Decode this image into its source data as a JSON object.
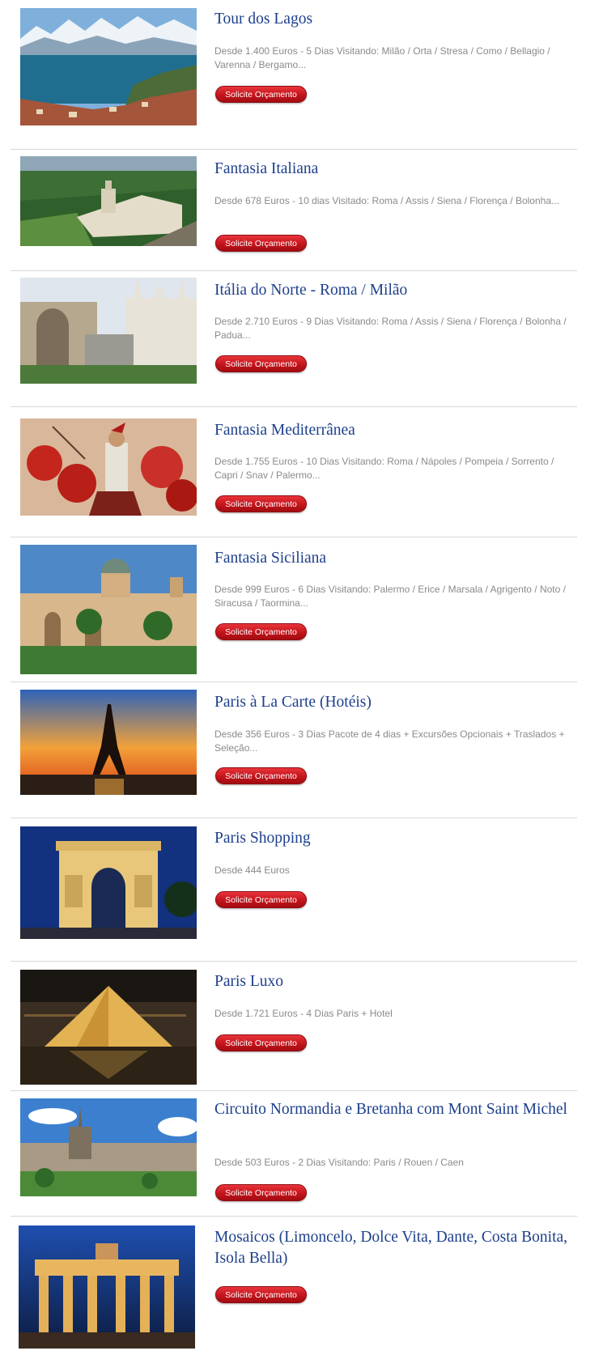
{
  "tours": [
    {
      "title": "Tour dos Lagos",
      "description": "Desde 1.400 Euros - 5 Dias Visitando: Milão / Orta / Stresa / Como / Bellagio / Varenna / Bergamo...",
      "button": "Solicite Orçamento",
      "image": "lake-mountains-photo"
    },
    {
      "title": "Fantasia Italiana",
      "description": "Desde 678 Euros - 10 dias  Visitado: Roma / Assis / Siena / Florença / Bolonha...",
      "button": "Solicite Orçamento",
      "image": "assisi-basilica-photo"
    },
    {
      "title": "Itália do Norte - Roma / Milão",
      "description": "Desde 2.710 Euros - 9 Dias Visitando: Roma / Assis / Siena / Florença / Bolonha / Padua...",
      "button": "Solicite Orçamento",
      "image": "milan-cathedral-photo"
    },
    {
      "title": "Fantasia Mediterrânea",
      "description": "Desde 1.755 Euros - 10 Dias Visitando: Roma / Nápoles / Pompeia / Sorrento / Capri / Snav / Palermo...",
      "button": "Solicite Orçamento",
      "image": "roman-soldiers-painting"
    },
    {
      "title": "Fantasia Siciliana",
      "description": "Desde 999 Euros - 6 Dias Visitando: Palermo / Erice / Marsala / Agrigento / Noto / Siracusa / Taormina...",
      "button": "Solicite Orçamento",
      "image": "palermo-cathedral-photo"
    },
    {
      "title": "Paris à La Carte (Hotéis)",
      "description": "Desde 356 Euros - 3 Dias Pacote de 4 dias + Excursões Opcionais + Traslados + Seleção...",
      "button": "Solicite Orçamento",
      "image": "eiffel-tower-sunset-photo"
    },
    {
      "title": "Paris Shopping",
      "description": "Desde 444 Euros",
      "button": "Solicite Orçamento",
      "image": "arc-de-triomphe-photo"
    },
    {
      "title": "Paris Luxo",
      "description": "Desde 1.721 Euros - 4 Dias Paris + Hotel",
      "button": "Solicite Orçamento",
      "image": "louvre-pyramid-photo"
    },
    {
      "title": "Circuito Normandia e Bretanha com Mont Saint Michel",
      "description": "Desde 503 Euros - 2 Dias Visitando: Paris / Rouen / Caen",
      "button": "Solicite Orçamento",
      "image": "rouen-cityscape-photo"
    },
    {
      "title": "Mosaicos (Limoncelo, Dolce Vita, Dante, Costa Bonita, Isola Bella)",
      "description": "",
      "button": "Solicite Orçamento",
      "image": "brandenburg-gate-photo"
    }
  ]
}
